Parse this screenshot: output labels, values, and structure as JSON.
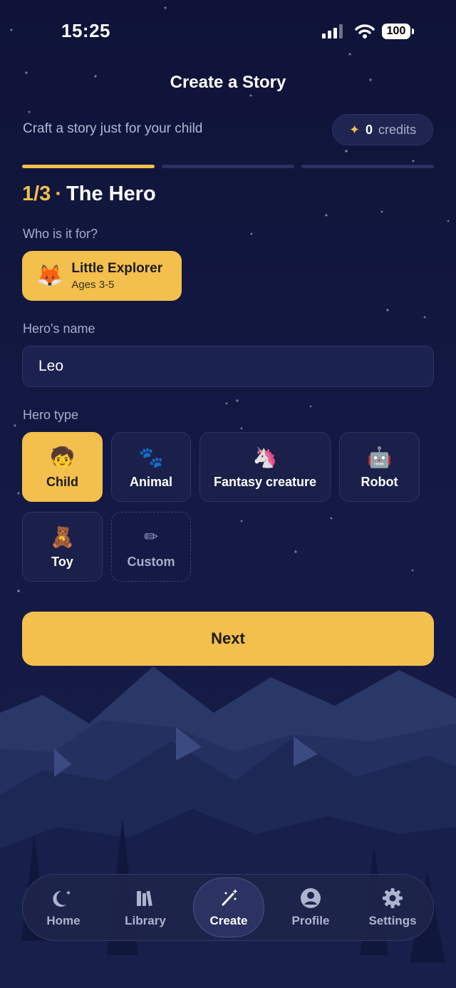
{
  "status_bar": {
    "time": "15:25",
    "battery": "100"
  },
  "header": {
    "title": "Create a Story",
    "subtitle": "Craft a story just for your child"
  },
  "credits": {
    "count": "0",
    "label": "credits",
    "icon": "sparkles-icon"
  },
  "progress": {
    "current_step": 1,
    "total_steps": 3
  },
  "step": {
    "fraction": "1/3",
    "separator": "·",
    "title": "The Hero"
  },
  "audience": {
    "label": "Who is it for?",
    "emoji": "🦊",
    "name": "Little Explorer",
    "ages": "Ages 3-5"
  },
  "hero_name": {
    "label": "Hero's name",
    "value": "Leo"
  },
  "hero_type": {
    "label": "Hero type",
    "options": [
      {
        "emoji": "🧒",
        "label": "Child",
        "selected": true
      },
      {
        "emoji": "🐾",
        "label": "Animal",
        "selected": false
      },
      {
        "emoji": "🦄",
        "label": "Fantasy creature",
        "selected": false
      },
      {
        "emoji": "🤖",
        "label": "Robot",
        "selected": false
      },
      {
        "emoji": "🧸",
        "label": "Toy",
        "selected": false
      },
      {
        "emoji": "✏",
        "label": "Custom",
        "selected": false
      }
    ]
  },
  "next_button": {
    "label": "Next"
  },
  "tabs": [
    {
      "label": "Home",
      "icon": "moon-stars-icon"
    },
    {
      "label": "Library",
      "icon": "books-icon"
    },
    {
      "label": "Create",
      "icon": "magic-wand-icon",
      "active": true
    },
    {
      "label": "Profile",
      "icon": "person-circle-icon"
    },
    {
      "label": "Settings",
      "icon": "gear-icon"
    }
  ],
  "colors": {
    "accent": "#f3bf4d",
    "background": "#141a45",
    "card": "#1a2049"
  }
}
